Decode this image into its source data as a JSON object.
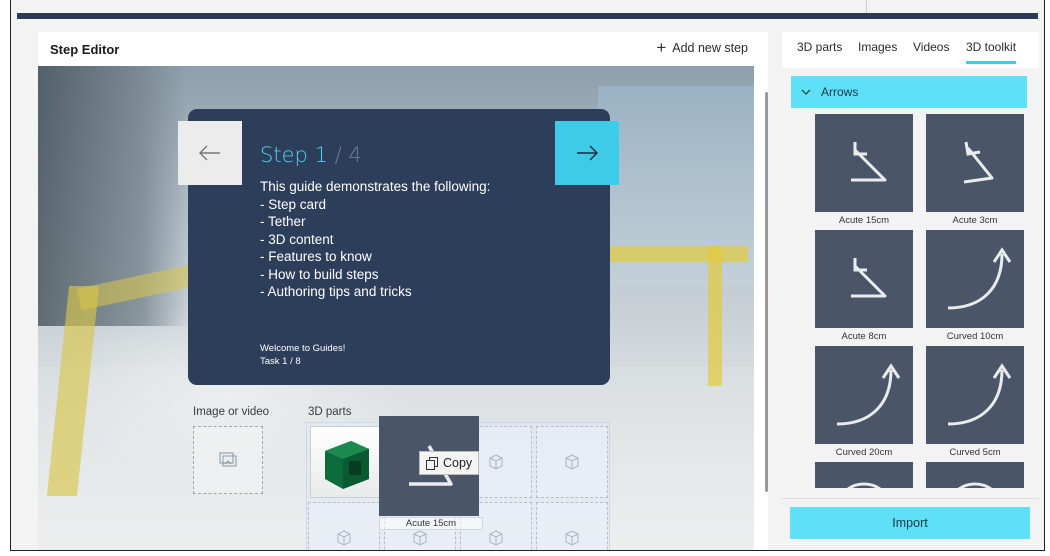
{
  "editor": {
    "title": "Step Editor",
    "add_step_label": "Add new step"
  },
  "step_card": {
    "step_word": "Step",
    "current": "1",
    "separator": " / ",
    "total": "4",
    "body_lines": [
      "This guide demonstrates the following:",
      "- Step card",
      "- Tether",
      "- 3D content",
      "- Features to know",
      "- How to build steps",
      "- Authoring tips and tricks"
    ],
    "footer_line1": "Welcome to Guides!",
    "footer_line2": "Task 1 / 8"
  },
  "bins": {
    "image_label": "Image or video",
    "parts_label": "3D parts"
  },
  "drag": {
    "caption": "Acute 15cm",
    "copy_label": "Copy"
  },
  "right_panel": {
    "tabs": [
      "3D parts",
      "Images",
      "Videos",
      "3D toolkit"
    ],
    "active_tab": "3D toolkit",
    "section_label": "Arrows",
    "tiles": [
      {
        "label": "Acute 15cm",
        "icon": "acute-arrow-icon"
      },
      {
        "label": "Acute 3cm",
        "icon": "acute-arrow-icon"
      },
      {
        "label": "Acute 8cm",
        "icon": "acute-arrow-icon"
      },
      {
        "label": "Curved 10cm",
        "icon": "curved-arrow-icon"
      },
      {
        "label": "Curved 20cm",
        "icon": "curved-arrow-icon"
      },
      {
        "label": "Curved 5cm",
        "icon": "curved-arrow-icon"
      }
    ],
    "import_label": "Import"
  },
  "colors": {
    "accent": "#3ecbe8",
    "card_bg": "#2d3e5a",
    "tile_bg": "#4a5568"
  }
}
